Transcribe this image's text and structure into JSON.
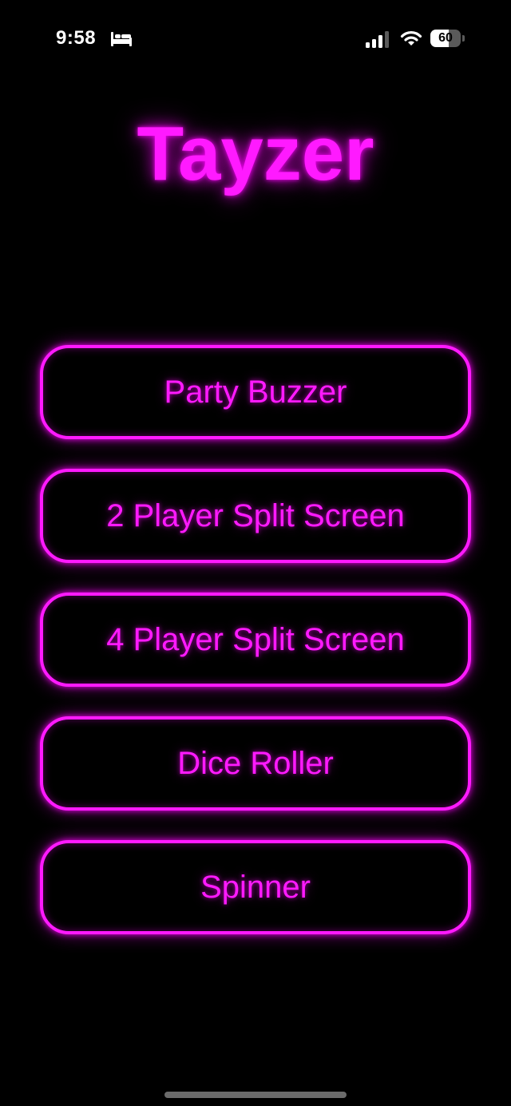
{
  "status_bar": {
    "time": "9:58",
    "focus_icon": "bed-icon",
    "signal_icon": "cellular-signal-icon",
    "wifi_icon": "wifi-icon",
    "battery_level": "60"
  },
  "app": {
    "title": "Tayzer"
  },
  "menu": {
    "items": [
      {
        "label": "Party Buzzer"
      },
      {
        "label": "2 Player Split Screen"
      },
      {
        "label": "4 Player Split Screen"
      },
      {
        "label": "Dice Roller"
      },
      {
        "label": "Spinner"
      }
    ]
  },
  "colors": {
    "background": "#000000",
    "neon_accent": "#ff1aff",
    "status_text": "#ffffff"
  }
}
